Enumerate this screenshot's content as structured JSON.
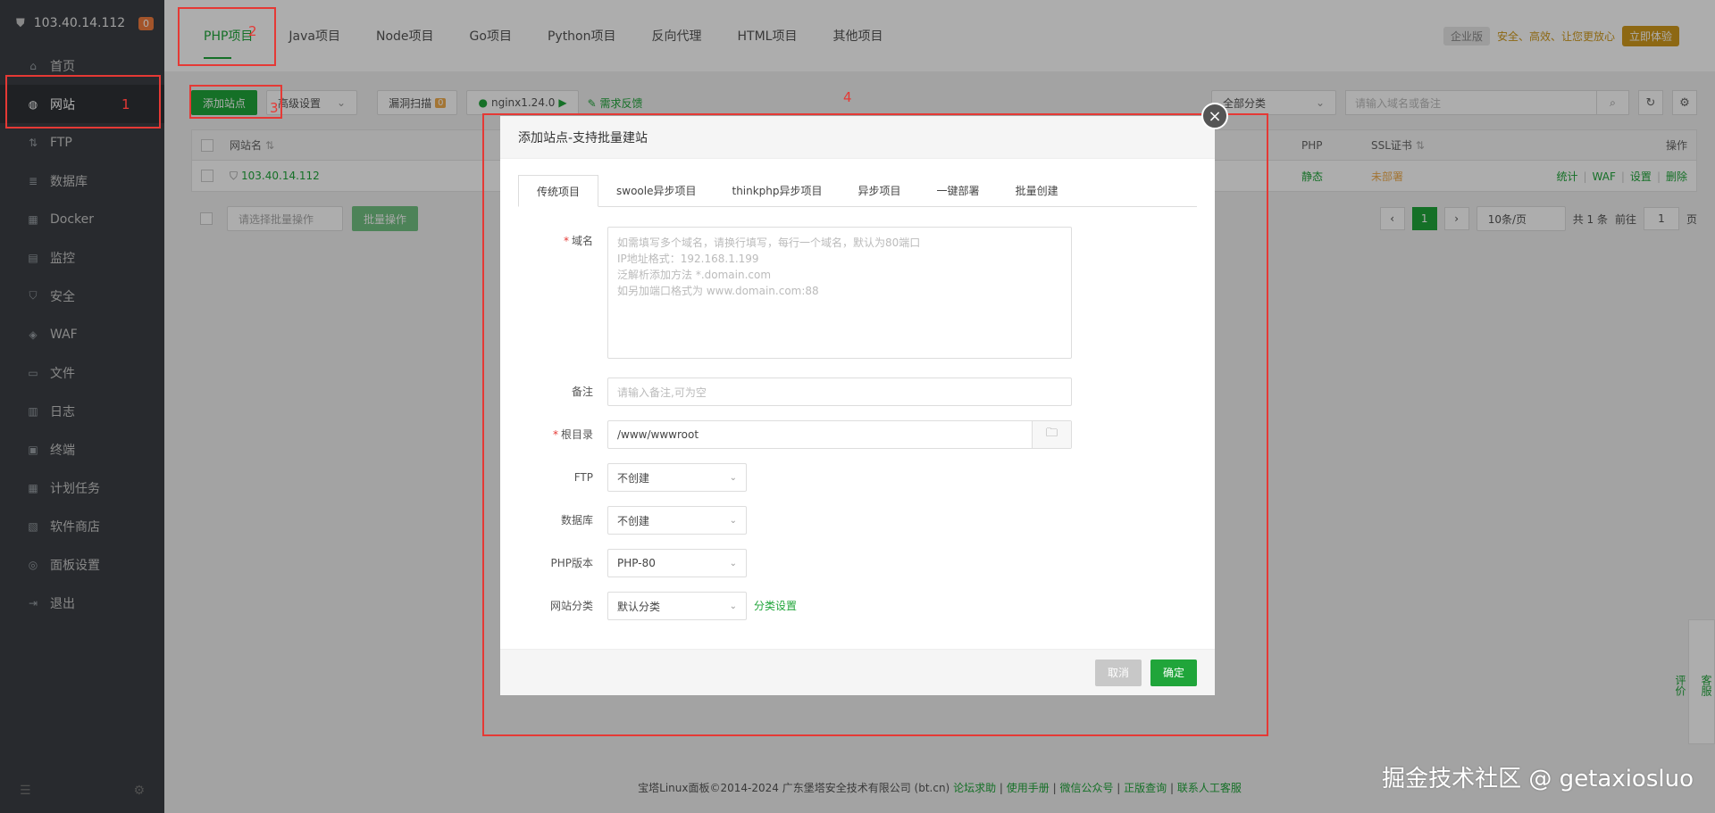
{
  "sidebar": {
    "server_ip": "103.40.14.112",
    "badge": "0",
    "items": [
      {
        "label": "首页",
        "icon": "home-icon"
      },
      {
        "label": "网站",
        "icon": "globe-icon"
      },
      {
        "label": "FTP",
        "icon": "ftp-icon"
      },
      {
        "label": "数据库",
        "icon": "database-icon"
      },
      {
        "label": "Docker",
        "icon": "docker-icon"
      },
      {
        "label": "监控",
        "icon": "monitor-icon"
      },
      {
        "label": "安全",
        "icon": "shield-icon"
      },
      {
        "label": "WAF",
        "icon": "waf-icon"
      },
      {
        "label": "文件",
        "icon": "folder-icon"
      },
      {
        "label": "日志",
        "icon": "log-icon"
      },
      {
        "label": "终端",
        "icon": "terminal-icon"
      },
      {
        "label": "计划任务",
        "icon": "calendar-icon"
      },
      {
        "label": "软件商店",
        "icon": "store-icon"
      },
      {
        "label": "面板设置",
        "icon": "settings-icon"
      },
      {
        "label": "退出",
        "icon": "logout-icon"
      }
    ]
  },
  "tabs": [
    "PHP项目",
    "Java项目",
    "Node项目",
    "Go项目",
    "Python项目",
    "反向代理",
    "HTML项目",
    "其他项目"
  ],
  "promo": {
    "pro": "企业版",
    "slogan": "安全、高效、让您更放心",
    "try": "立即体验"
  },
  "toolbar": {
    "add_site": "添加站点",
    "advanced": "高级设置",
    "vuln_scan": "漏洞扫描",
    "vuln_count": "0",
    "nginx": "nginx1.24.0",
    "feedback": "需求反馈",
    "category": "全部分类",
    "search_placeholder": "请输入域名或备注"
  },
  "table": {
    "headers": {
      "name": "网站名",
      "php": "PHP",
      "ssl": "SSL证书",
      "ops": "操作"
    },
    "row": {
      "site": "103.40.14.112",
      "php": "静态",
      "ssl": "未部署",
      "ops": [
        "统计",
        "WAF",
        "设置",
        "删除"
      ]
    }
  },
  "bulk": {
    "select": "请选择批量操作",
    "apply": "批量操作"
  },
  "pager": {
    "current": "1",
    "per_page": "10条/页",
    "total": "共 1 条",
    "goto": "前往",
    "page_input": "1",
    "page_unit": "页"
  },
  "footer": {
    "copyright": "宝塔Linux面板©2014-2024 广东堡塔安全技术有限公司 (bt.cn)",
    "links": [
      "论坛求助",
      "使用手册",
      "微信公众号",
      "正版查询",
      "联系人工客服"
    ]
  },
  "side_help": {
    "service": "客服",
    "rate": "评价"
  },
  "watermark": "掘金技术社区 @ getaxiosluo",
  "annotations": [
    "1",
    "2",
    "3",
    "4"
  ],
  "dialog": {
    "title": "添加站点-支持批量建站",
    "tabs": [
      "传统项目",
      "swoole异步项目",
      "thinkphp异步项目",
      "异步项目",
      "一键部署",
      "批量创建"
    ],
    "domain_label": "域名",
    "domain_placeholder": "如需填写多个域名，请换行填写，每行一个域名，默认为80端口\nIP地址格式：192.168.1.199\n泛解析添加方法 *.domain.com\n如另加端口格式为 www.domain.com:88",
    "remark_label": "备注",
    "remark_placeholder": "请输入备注,可为空",
    "root_label": "根目录",
    "root_value": "/www/wwwroot",
    "ftp_label": "FTP",
    "ftp_value": "不创建",
    "db_label": "数据库",
    "db_value": "不创建",
    "php_label": "PHP版本",
    "php_value": "PHP-80",
    "cat_label": "网站分类",
    "cat_value": "默认分类",
    "cat_settings": "分类设置",
    "cancel": "取消",
    "confirm": "确定"
  },
  "colors": {
    "accent": "#20a53a",
    "annotation": "#e53935",
    "sidebar": "#3b3f44"
  }
}
